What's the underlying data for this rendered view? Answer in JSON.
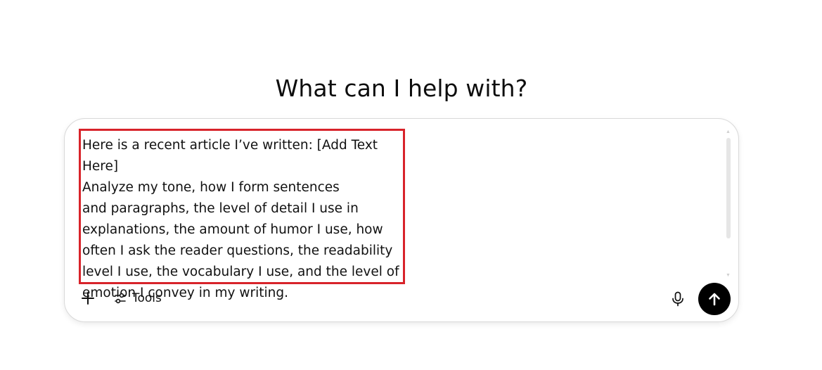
{
  "main": {
    "headline": "What can I help with?"
  },
  "composer": {
    "prompt_text": "Here is a recent article I’ve written: [Add Text Here]\nAnalyze my tone, how I form sentences\nand paragraphs, the level of detail I use in\nexplanations, the amount of humor I use, how\noften I ask the reader questions, the readability\nlevel I use, the vocabulary I use, and the level of\nemotion I convey in my writing.",
    "tools_label": "Tools",
    "highlight_color": "#d8232a",
    "send_button_color": "#000000"
  },
  "icons": {
    "plus": "plus-icon",
    "tools": "sliders-icon",
    "mic": "microphone-icon",
    "send": "arrow-up-icon"
  }
}
